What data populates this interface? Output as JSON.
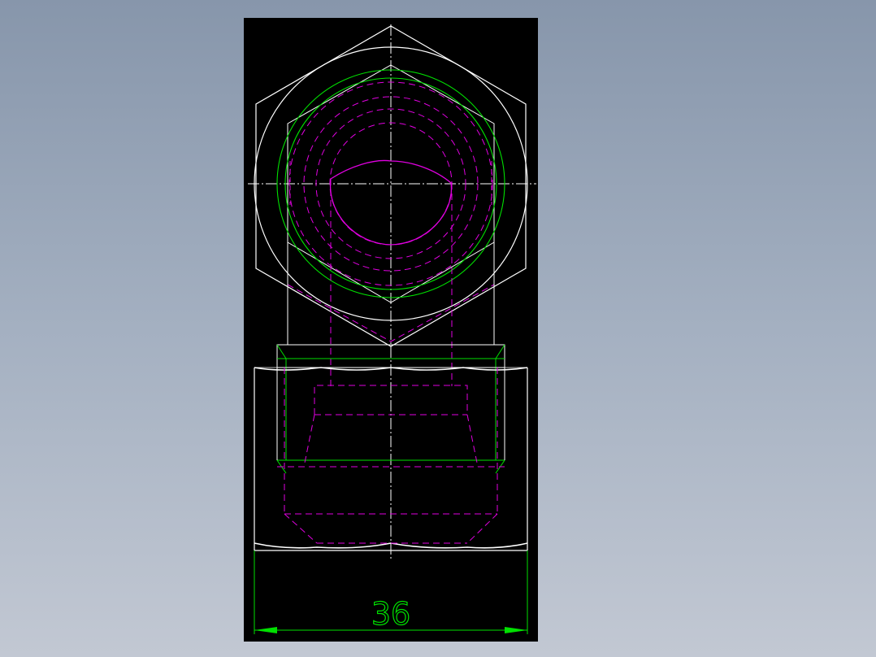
{
  "drawing": {
    "dimension_label": "36"
  },
  "colors": {
    "background_top": "#8796ab",
    "background_bottom": "#c2c8d3",
    "sheet": "#000000",
    "outline": "#ffffff",
    "hidden_lines": "#e000e0",
    "dimension": "#00e000"
  }
}
